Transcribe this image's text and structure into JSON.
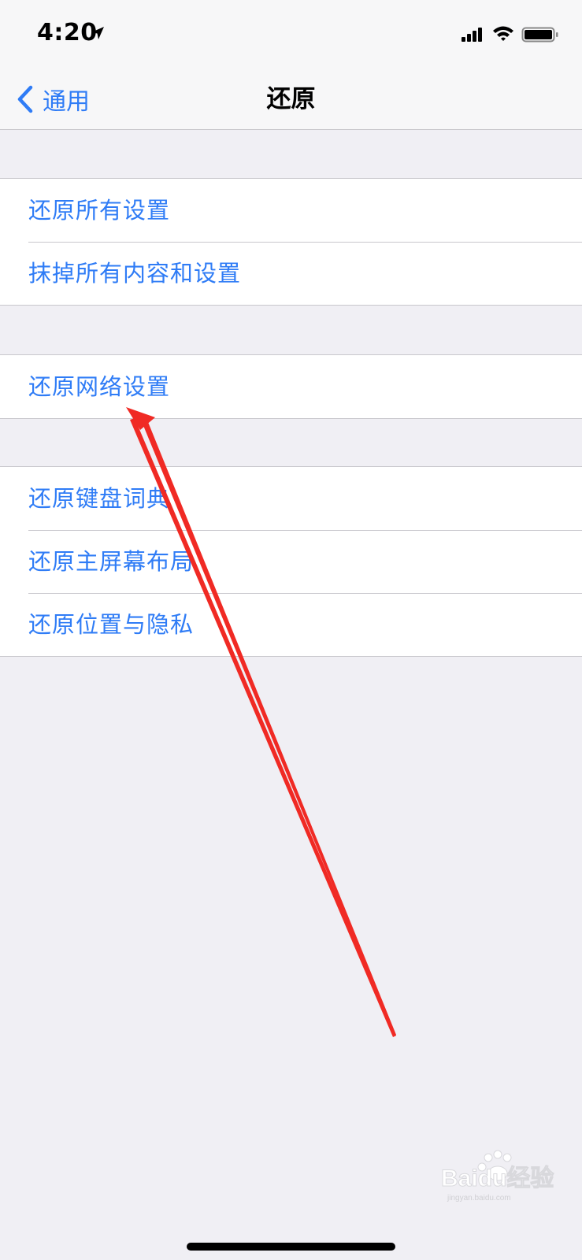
{
  "status_bar": {
    "time": "4:20",
    "icons": [
      "location-arrow-icon",
      "cellular-signal-icon",
      "wifi-icon",
      "battery-icon"
    ]
  },
  "nav": {
    "back_label": "通用",
    "title": "还原"
  },
  "groups": [
    {
      "items": [
        {
          "label": "还原所有设置"
        },
        {
          "label": "抹掉所有内容和设置"
        }
      ]
    },
    {
      "items": [
        {
          "label": "还原网络设置"
        }
      ]
    },
    {
      "items": [
        {
          "label": "还原键盘词典"
        },
        {
          "label": "还原主屏幕布局"
        },
        {
          "label": "还原位置与隐私"
        }
      ]
    }
  ],
  "watermark": {
    "brand": "Baidu经验",
    "domain": "jingyan.baidu.com"
  },
  "colors": {
    "accent": "#2f7cf6",
    "background": "#f0eff4",
    "cell_background": "#ffffff",
    "separator": "#c8c7cc",
    "annotation_arrow": "#f02a24"
  }
}
